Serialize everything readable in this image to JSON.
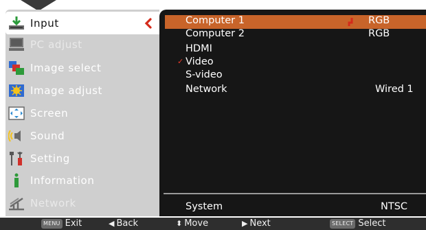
{
  "sidebar": {
    "items": [
      {
        "label": "Input",
        "icon": "input-icon",
        "state": "active"
      },
      {
        "label": "PC adjust",
        "icon": "pc-adjust-icon",
        "state": "dim"
      },
      {
        "label": "Image select",
        "icon": "image-select-icon",
        "state": "normal"
      },
      {
        "label": "Image adjust",
        "icon": "image-adjust-icon",
        "state": "normal"
      },
      {
        "label": "Screen",
        "icon": "screen-icon",
        "state": "normal"
      },
      {
        "label": "Sound",
        "icon": "sound-icon",
        "state": "normal"
      },
      {
        "label": "Setting",
        "icon": "setting-icon",
        "state": "normal"
      },
      {
        "label": "Information",
        "icon": "information-icon",
        "state": "normal"
      },
      {
        "label": "Network",
        "icon": "network-icon",
        "state": "dim"
      }
    ]
  },
  "input_list": {
    "rows": [
      {
        "name": "Computer 1",
        "value": "RGB",
        "selected": true,
        "marked": false
      },
      {
        "name": "Computer 2",
        "value": "RGB",
        "selected": false,
        "marked": false
      },
      {
        "name": "HDMI",
        "value": "",
        "selected": false,
        "marked": false
      },
      {
        "name": "Video",
        "value": "",
        "selected": false,
        "marked": true
      },
      {
        "name": "S-video",
        "value": "",
        "selected": false,
        "marked": false
      },
      {
        "name": "Network",
        "value": "Wired 1",
        "selected": false,
        "marked": false
      }
    ],
    "system": {
      "label": "System",
      "value": "NTSC"
    }
  },
  "footer": {
    "exit_key": "MENU",
    "exit_label": "Exit",
    "back_label": "Back",
    "move_label": "Move",
    "next_label": "Next",
    "select_key": "SELECT",
    "select_label": "Select"
  },
  "colors": {
    "highlight": "#c8642a",
    "panel": "#161616",
    "sidebar": "#cfcfcf",
    "check": "#e83a2a"
  }
}
